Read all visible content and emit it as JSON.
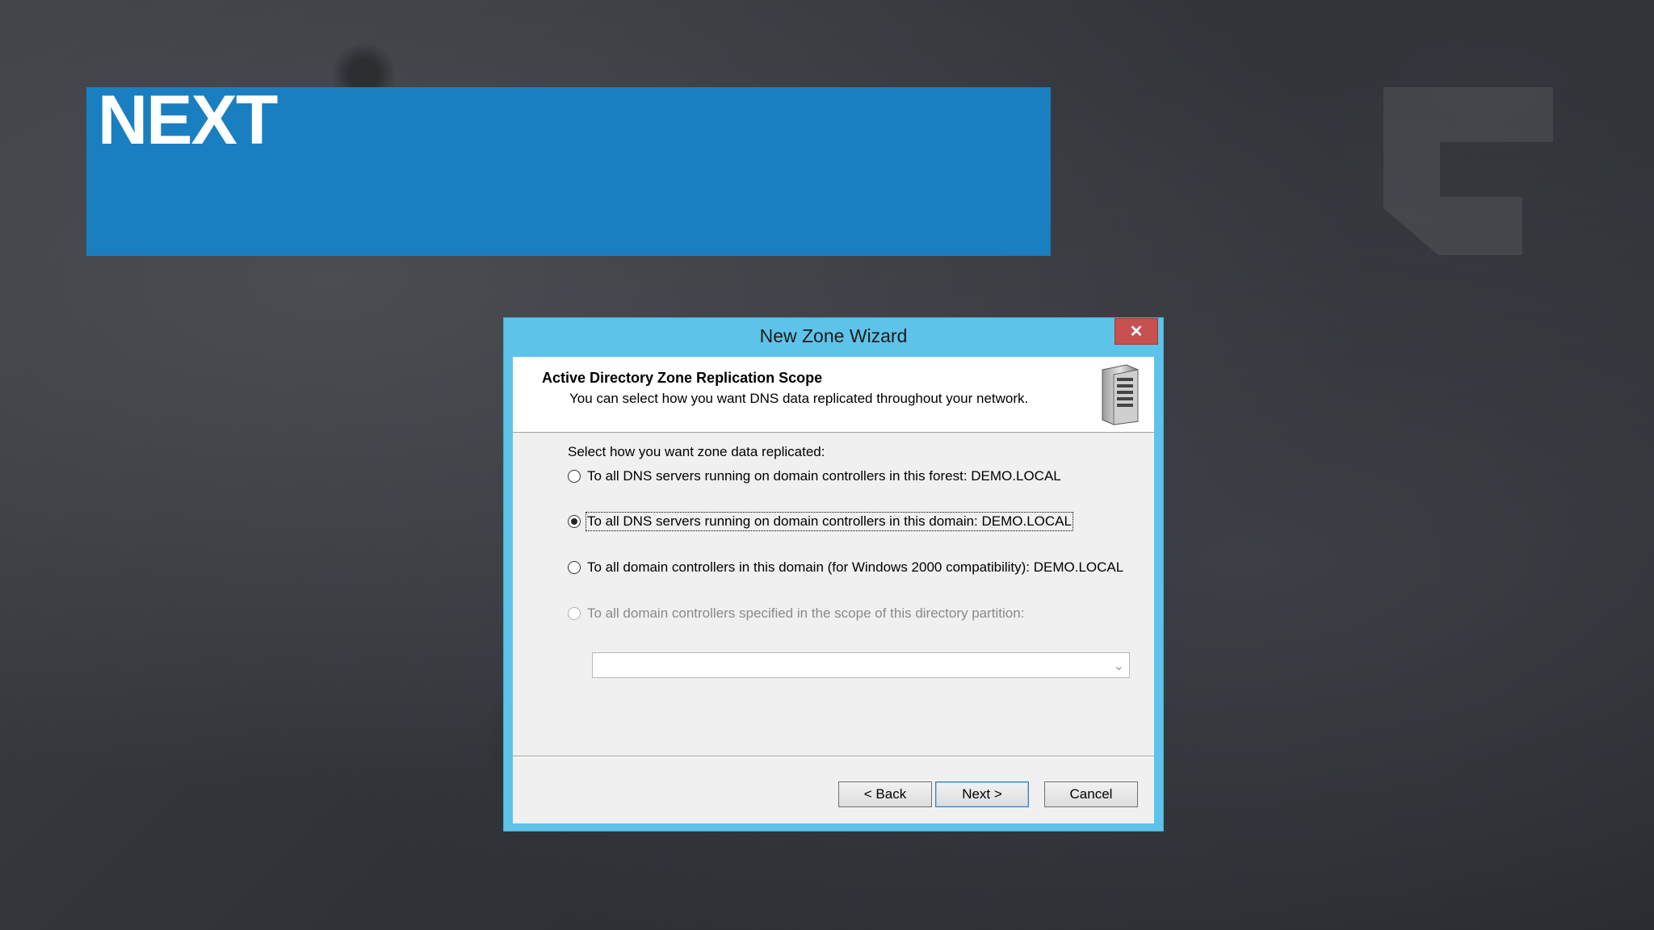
{
  "slide": {
    "title": "NEXT"
  },
  "dialog": {
    "title": "New Zone Wizard",
    "close_label": "✕",
    "header_title": "Active Directory Zone Replication Scope",
    "header_subtitle": "You can select how you want DNS data replicated throughout your network.",
    "prompt": "Select how you want zone data replicated:",
    "options": [
      {
        "label": "To all DNS servers running on domain controllers in this forest: DEMO.LOCAL",
        "selected": false,
        "enabled": true
      },
      {
        "label": "To all DNS servers running on domain controllers in this domain: DEMO.LOCAL",
        "selected": true,
        "enabled": true
      },
      {
        "label": "To all domain controllers in this domain (for Windows 2000 compatibility): DEMO.LOCAL",
        "selected": false,
        "enabled": true
      },
      {
        "label": "To all domain controllers specified in the scope of this directory partition:",
        "selected": false,
        "enabled": false
      }
    ],
    "partition_combo_value": "",
    "buttons": {
      "back": "< Back",
      "next": "Next >",
      "cancel": "Cancel"
    }
  },
  "colors": {
    "banner": "#1a7fc1",
    "dialog_frame": "#5ec3e8",
    "close_button": "#c75050"
  }
}
